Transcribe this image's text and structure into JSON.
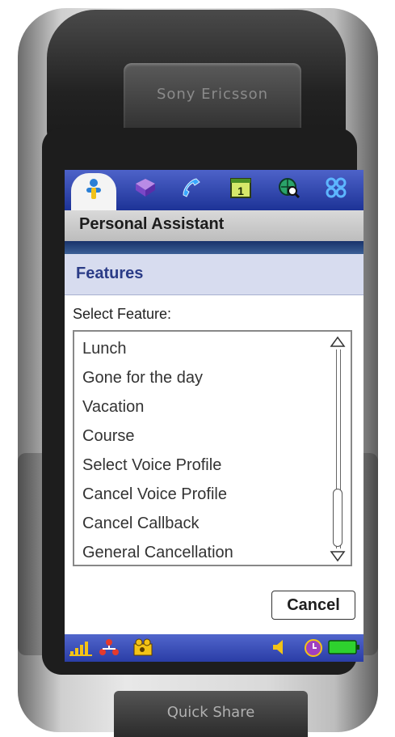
{
  "device": {
    "brand": "Sony Ericsson",
    "bottom_button": "Quick Share"
  },
  "tabs": [
    {
      "icon": "person-icon"
    },
    {
      "icon": "book-icon"
    },
    {
      "icon": "phone-icon"
    },
    {
      "icon": "calendar-icon",
      "label": "1"
    },
    {
      "icon": "globe-icon"
    },
    {
      "icon": "grid-icon"
    }
  ],
  "app": {
    "title": "Personal Assistant"
  },
  "dialog": {
    "title": "Features",
    "prompt": "Select Feature:",
    "items": [
      "Lunch",
      "Gone for the day",
      "Vacation",
      "Course",
      "Select Voice Profile",
      "Cancel Voice Profile",
      "Cancel Callback",
      "General Cancellation"
    ],
    "cancel_label": "Cancel"
  },
  "statusbar": {
    "icons": [
      "signal-icon",
      "network-icon",
      "camera-icon",
      "volume-icon",
      "clock-icon",
      "battery-icon"
    ]
  },
  "colors": {
    "tabbar": "#2b3fa8",
    "dialog_title": "#2b3c87",
    "dialog_header_bg": "#d7dcef"
  }
}
